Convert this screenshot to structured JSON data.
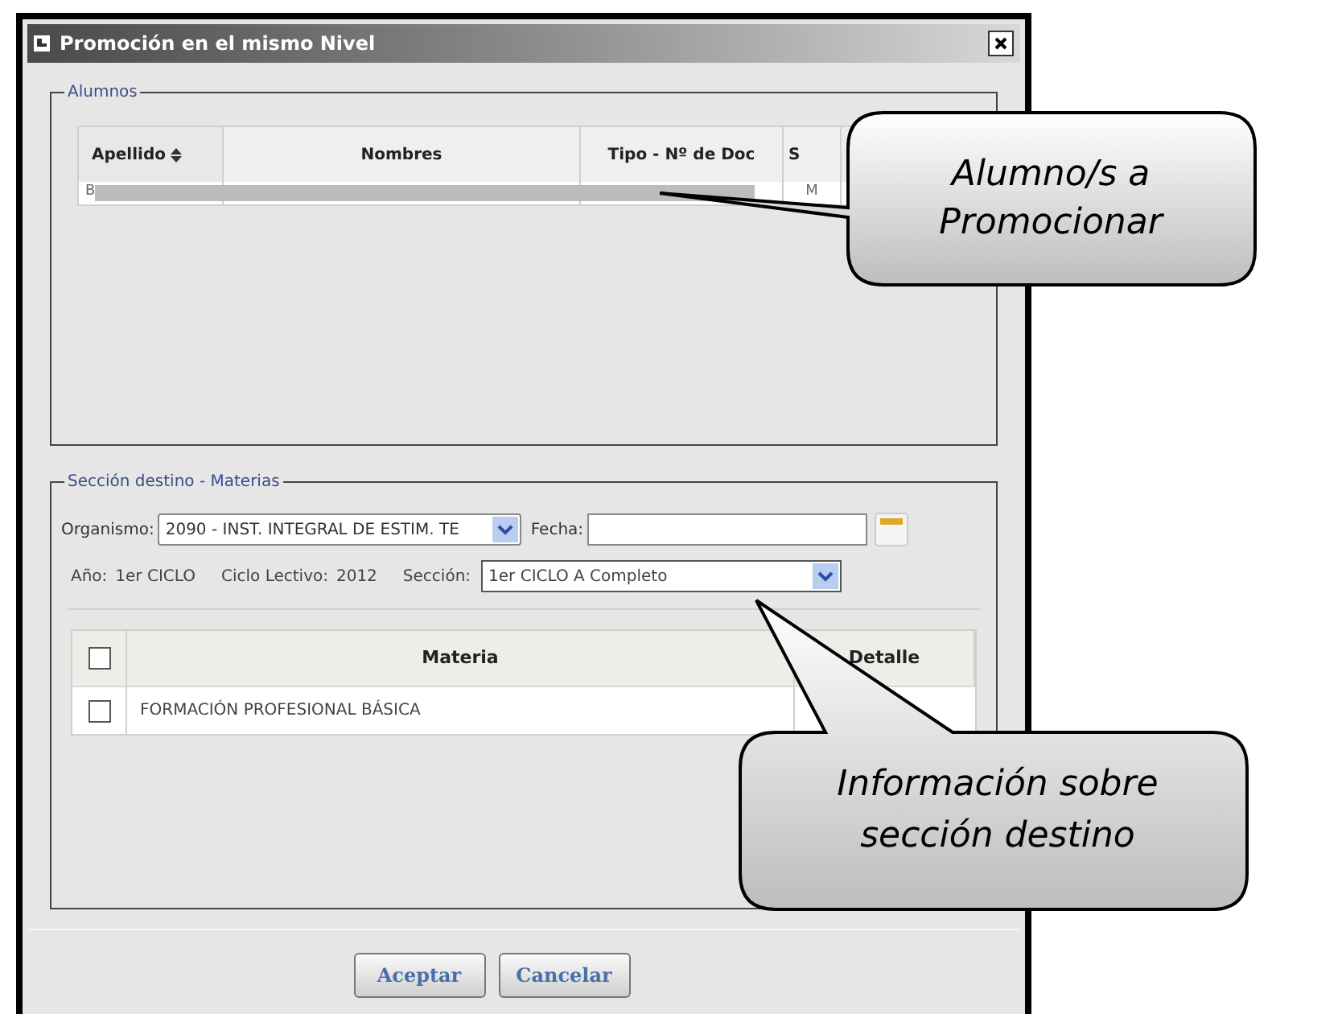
{
  "window": {
    "title": "Promoción en el mismo Nivel"
  },
  "alumnos": {
    "legend": "Alumnos",
    "columns": [
      {
        "label": "Apellido",
        "sortable": true
      },
      {
        "label": "Nombres",
        "sortable": false
      },
      {
        "label": "Tipo - Nº de Doc",
        "sortable": false
      },
      {
        "label": "S",
        "sortable": false
      }
    ],
    "rows": [
      {
        "cells": [
          "B",
          "",
          "",
          "M"
        ],
        "redacted": true
      }
    ]
  },
  "seccion_destino": {
    "legend": "Sección destino - Materias",
    "organismo": {
      "label": "Organismo:",
      "value": "2090 - INST. INTEGRAL DE ESTIM. TE"
    },
    "fecha": {
      "label": "Fecha:"
    },
    "info": [
      {
        "label": "Año:",
        "value": "1er CICLO"
      },
      {
        "label": "Ciclo Lectivo:",
        "value": "2012"
      }
    ],
    "seccion": {
      "label": "Sección:",
      "value": "1er CICLO A Completo"
    },
    "materias": {
      "header_checked": false,
      "columns": [
        "Materia",
        "Detalle"
      ],
      "rows": [
        {
          "checked": false,
          "materia": "FORMACIÓN PROFESIONAL BÁSICA"
        }
      ]
    }
  },
  "buttons": [
    "Aceptar",
    "Cancelar"
  ],
  "callouts": [
    {
      "text": "Alumno/s a Promocionar"
    },
    {
      "text": "Información sobre sección destino"
    }
  ]
}
